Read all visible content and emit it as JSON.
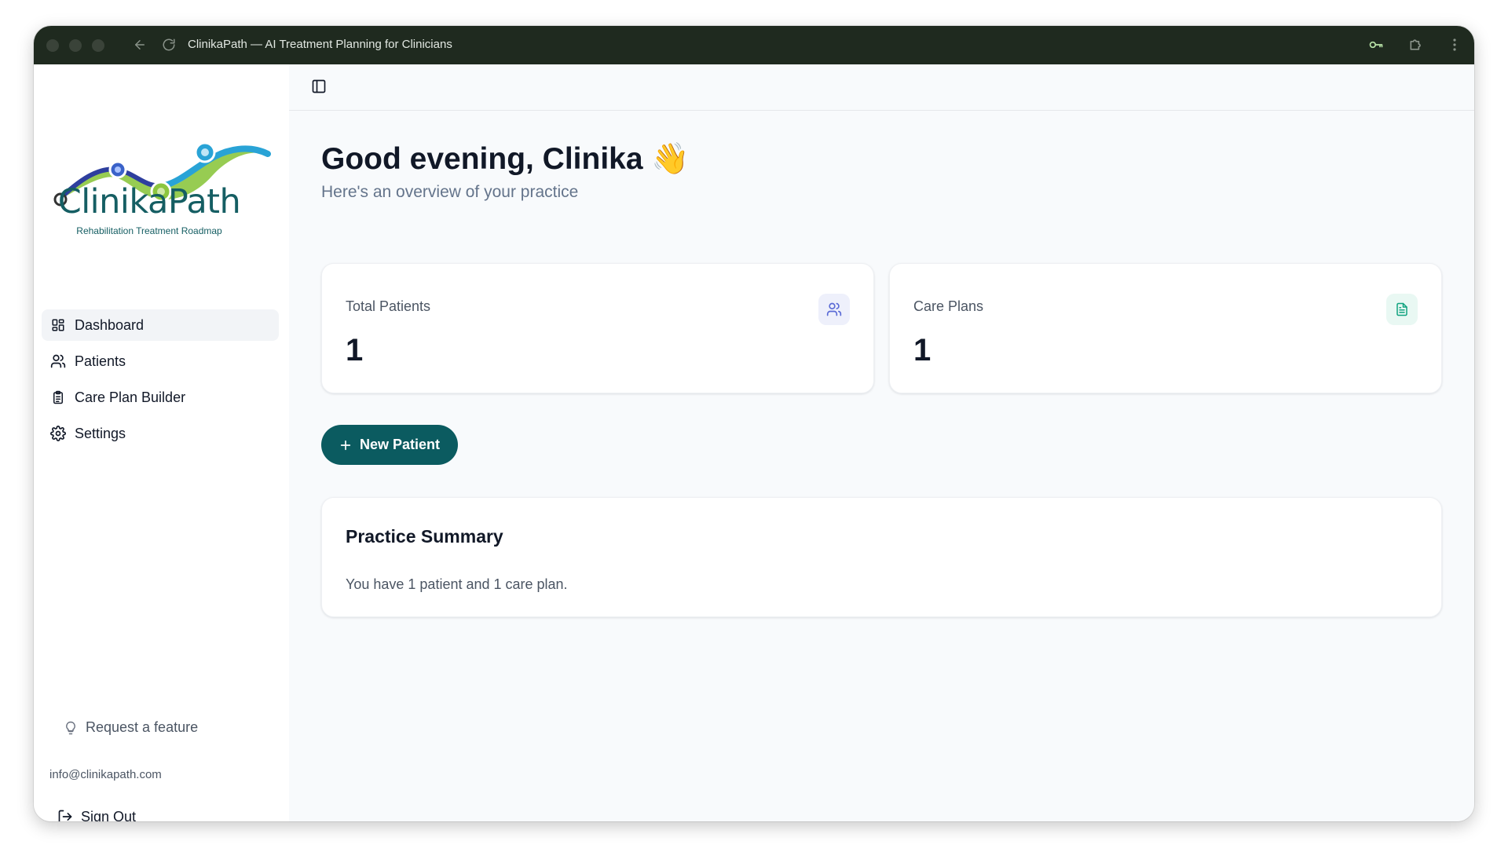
{
  "browser": {
    "title": "ClinikaPath — AI Treatment Planning for Clinicians"
  },
  "sidebar": {
    "logo": {
      "name": "ClinikaPath",
      "tagline": "Rehabilitation Treatment Roadmap"
    },
    "nav": [
      {
        "label": "Dashboard",
        "icon": "dashboard-icon",
        "active": true
      },
      {
        "label": "Patients",
        "icon": "users-icon",
        "active": false
      },
      {
        "label": "Care Plan Builder",
        "icon": "clipboard-icon",
        "active": false
      },
      {
        "label": "Settings",
        "icon": "gear-icon",
        "active": false
      }
    ],
    "request_feature": "Request a feature",
    "email": "info@clinikapath.com",
    "sign_out": "Sign Out"
  },
  "main": {
    "greeting": "Good evening, Clinika 👋",
    "subtitle": "Here's an overview of your practice",
    "stats": [
      {
        "label": "Total Patients",
        "value": "1",
        "icon": "users-icon",
        "icon_color": "#5b6bd6",
        "icon_bg": "#eef0fb"
      },
      {
        "label": "Care Plans",
        "value": "1",
        "icon": "document-icon",
        "icon_color": "#10a37f",
        "icon_bg": "#e9f8f3"
      }
    ],
    "new_patient_label": "New Patient",
    "summary": {
      "title": "Practice Summary",
      "text": "You have 1 patient and 1 care plan."
    }
  },
  "colors": {
    "brand_teal": "#0b5b60",
    "titlebar": "#1f2a1f"
  }
}
